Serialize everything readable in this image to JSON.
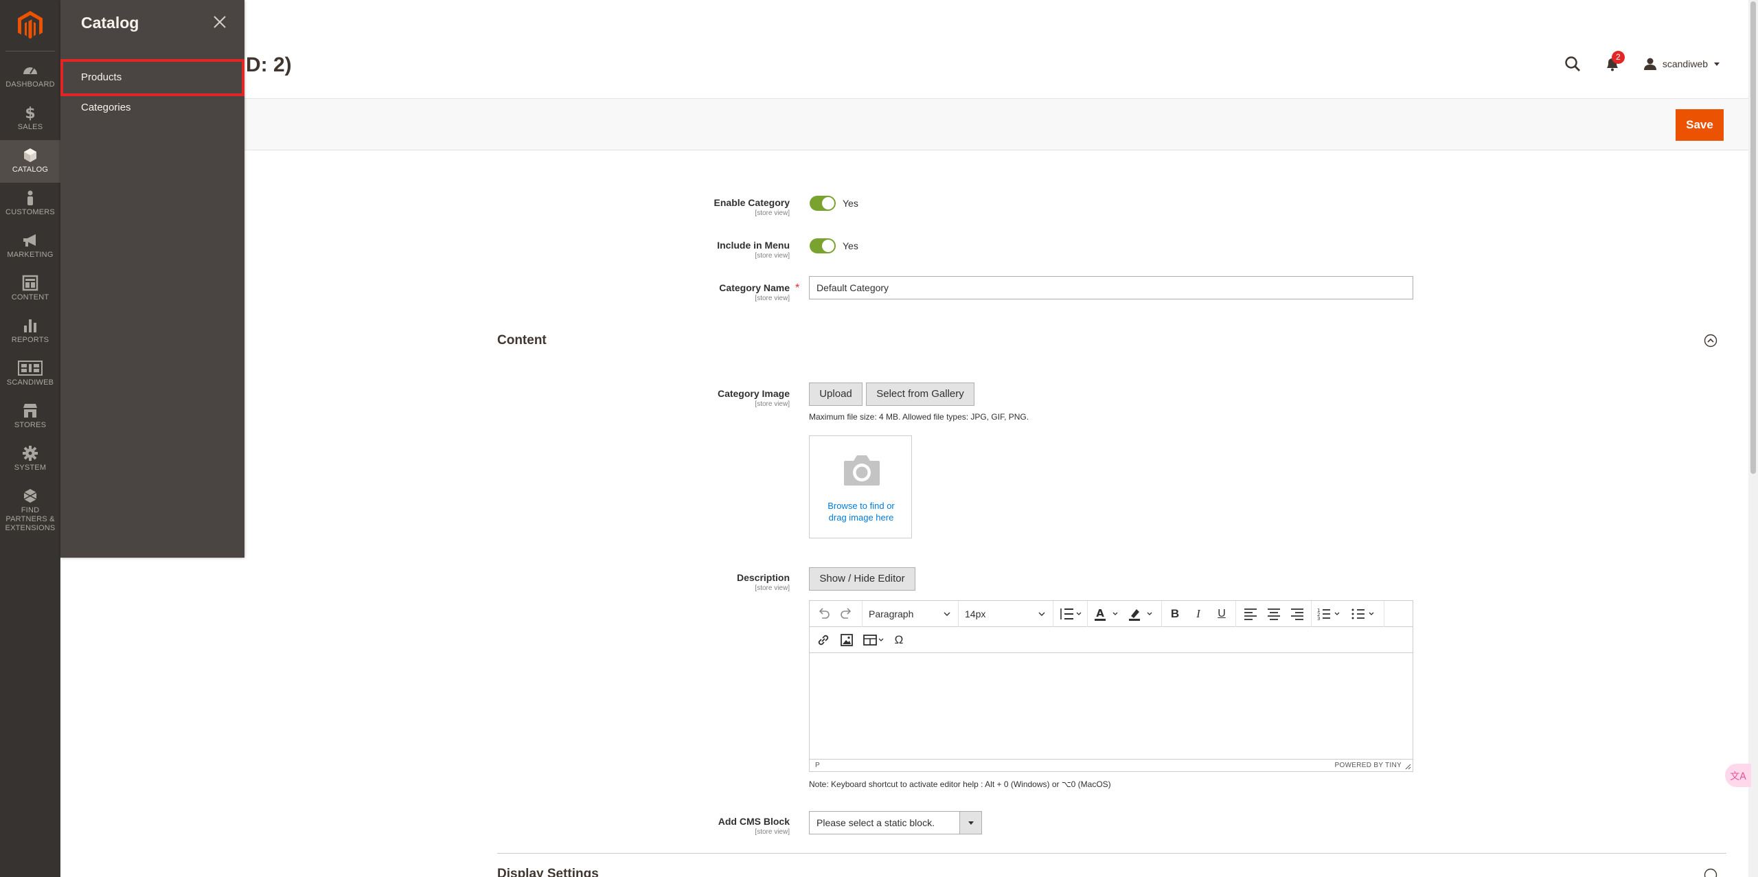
{
  "nav": {
    "items": [
      {
        "label": "DASHBOARD",
        "icon": "dashboard-icon"
      },
      {
        "label": "SALES",
        "icon": "dollar-icon"
      },
      {
        "label": "CATALOG",
        "icon": "catalog-box-icon"
      },
      {
        "label": "CUSTOMERS",
        "icon": "person-icon"
      },
      {
        "label": "MARKETING",
        "icon": "megaphone-icon"
      },
      {
        "label": "CONTENT",
        "icon": "content-layout-icon"
      },
      {
        "label": "REPORTS",
        "icon": "bar-chart-icon"
      },
      {
        "label": "SCANDIWEB",
        "icon": "scandiweb-icon"
      },
      {
        "label": "STORES",
        "icon": "store-icon"
      },
      {
        "label": "SYSTEM",
        "icon": "gear-icon"
      },
      {
        "label": "FIND PARTNERS & EXTENSIONS",
        "icon": "extensions-icon"
      }
    ]
  },
  "flyout": {
    "title": "Catalog",
    "items": [
      {
        "label": "Products"
      },
      {
        "label": "Categories"
      }
    ]
  },
  "header": {
    "title": "D: 2)",
    "notifications_count": "2",
    "user": "scandiweb"
  },
  "actions": {
    "save_label": "Save"
  },
  "form": {
    "enable_category": {
      "label": "Enable Category",
      "scope": "[store view]",
      "value": "Yes"
    },
    "include_in_menu": {
      "label": "Include in Menu",
      "scope": "[store view]",
      "value": "Yes"
    },
    "category_name": {
      "label": "Category Name",
      "scope": "[store view]",
      "value": "Default Category",
      "required": "*"
    }
  },
  "content_section": {
    "title": "Content",
    "category_image": {
      "label": "Category Image",
      "scope": "[store view]",
      "upload_label": "Upload",
      "gallery_label": "Select from Gallery",
      "hint": "Maximum file size: 4 MB. Allowed file types: JPG, GIF, PNG.",
      "browse_line1": "Browse to find or",
      "browse_line2": "drag image here"
    },
    "description": {
      "label": "Description",
      "scope": "[store view]",
      "toggle_editor_label": "Show / Hide Editor",
      "block_format": "Paragraph",
      "font_size": "14px",
      "status_path": "P",
      "powered_by": "POWERED BY TINY",
      "note": "Note: Keyboard shortcut to activate editor help : Alt + 0 (Windows) or ⌥0 (MacOS)"
    },
    "cms_block": {
      "label": "Add CMS Block",
      "scope": "[store view]",
      "placeholder": "Please select a static block."
    }
  },
  "display_section": {
    "title": "Display Settings"
  },
  "colors": {
    "accent": "#eb5202",
    "toggle_on": "#79a22e",
    "nav_bg": "#373330",
    "flyout_bg": "#4a4542",
    "highlight": "#e22626"
  }
}
